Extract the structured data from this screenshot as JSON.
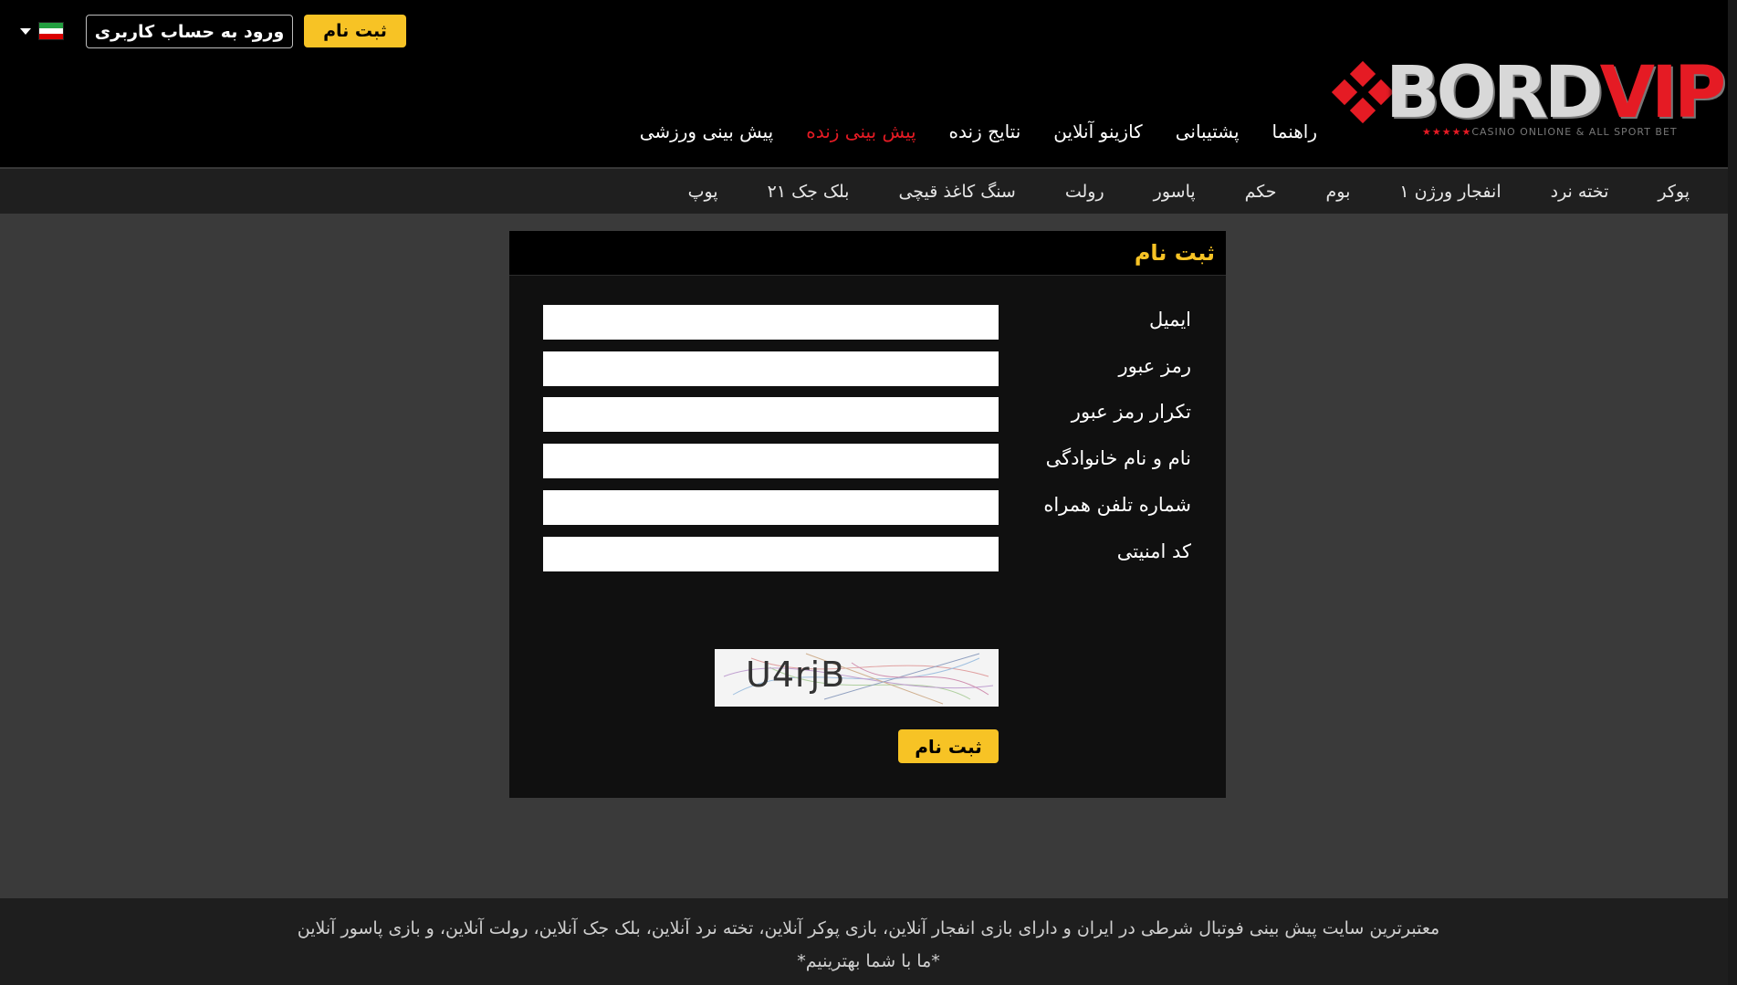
{
  "header": {
    "register_label": "ثبت نام",
    "login_label": "ورود به حساب کاربری",
    "language_flag": "iran-flag-icon",
    "logo": {
      "brand": "BORD",
      "brand_accent": "VIP",
      "tagline": "CASINO ONLIONE & ALL SPORT BET"
    }
  },
  "main_nav": [
    {
      "label": "پیش بینی ورزشی",
      "active": false
    },
    {
      "label": "پیش بینی زنده",
      "active": true
    },
    {
      "label": "نتایج زنده",
      "active": false
    },
    {
      "label": "کازینو آنلاین",
      "active": false
    },
    {
      "label": "پشتیبانی",
      "active": false
    },
    {
      "label": "راهنما",
      "active": false
    }
  ],
  "game_nav": [
    "پوکر",
    "تخته نرد",
    "انفجار ورژن ۱",
    "بوم",
    "حکم",
    "پاسور",
    "رولت",
    "سنگ کاغذ قیچی",
    "بلک جک ۲۱",
    "پوپ"
  ],
  "form": {
    "title": "ثبت نام",
    "fields": [
      {
        "label": "ایمیل",
        "value": "",
        "type": "email"
      },
      {
        "label": "رمز عبور",
        "value": "",
        "type": "password"
      },
      {
        "label": "تکرار رمز عبور",
        "value": "",
        "type": "password"
      },
      {
        "label": "نام و نام خانوادگی",
        "value": "",
        "type": "text"
      },
      {
        "label": "شماره تلفن همراه",
        "value": "",
        "type": "tel"
      },
      {
        "label": "کد امنیتی",
        "value": "",
        "type": "text"
      }
    ],
    "captcha_text": "U4rjB",
    "submit_label": "ثبت نام"
  },
  "footer": {
    "line1": "معتبرترین سایت پیش بینی فوتبال شرطی در ایران و دارای بازی انفجار آنلاین، بازی پوکر آنلاین، تخته نرد آنلاین، بلک جک آنلاین، رولت آنلاین، و بازی پاسور آنلاین",
    "line2": "*ما با شما بهترینیم*"
  },
  "colors": {
    "accent": "#f7c325",
    "brand_red": "#e51b24",
    "background": "#3a3a3a",
    "header": "#000000"
  }
}
